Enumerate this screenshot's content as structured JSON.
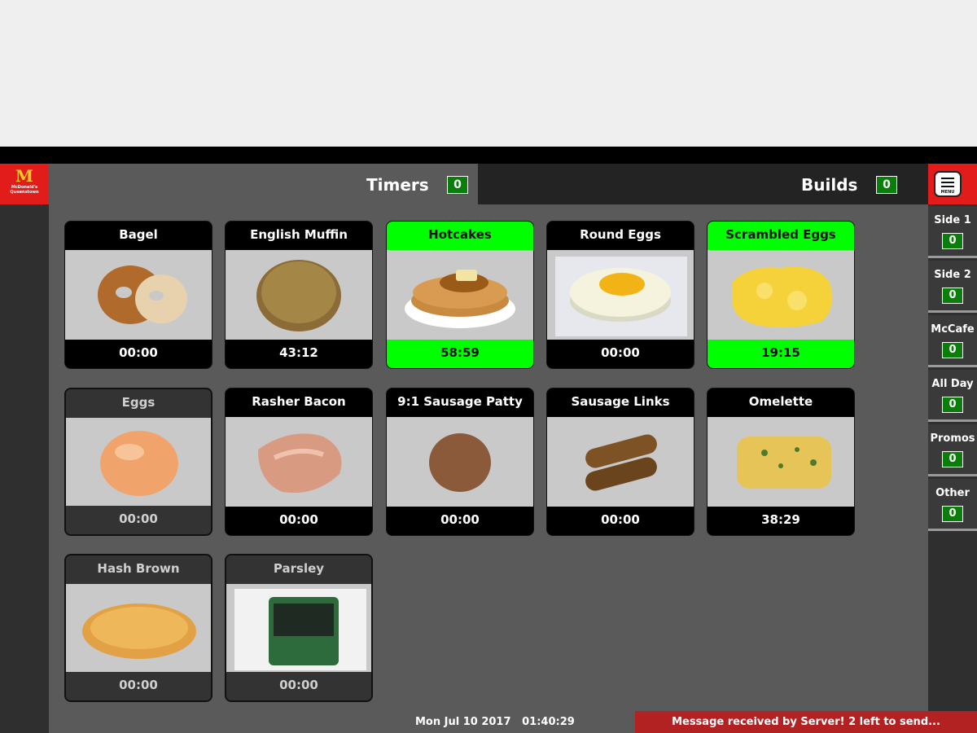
{
  "logo": {
    "store": "McDonald's Queenstown"
  },
  "tabs": {
    "timers": {
      "label": "Timers",
      "count": "0"
    },
    "builds": {
      "label": "Builds",
      "count": "0"
    }
  },
  "menu_label": "MENU",
  "side_items": [
    {
      "label": "Side 1",
      "count": "0"
    },
    {
      "label": "Side 2",
      "count": "0"
    },
    {
      "label": "McCafe",
      "count": "0"
    },
    {
      "label": "All Day",
      "count": "0"
    },
    {
      "label": "Promos",
      "count": "0"
    },
    {
      "label": "Other",
      "count": "0"
    }
  ],
  "tiles": [
    {
      "name": "Bagel",
      "time": "00:00",
      "state": "normal",
      "icon": "bagel-icon"
    },
    {
      "name": "English Muffin",
      "time": "43:12",
      "state": "normal",
      "icon": "english-muffin-icon"
    },
    {
      "name": "Hotcakes",
      "time": "58:59",
      "state": "active",
      "icon": "hotcakes-icon"
    },
    {
      "name": "Round Eggs",
      "time": "00:00",
      "state": "normal",
      "icon": "round-eggs-icon"
    },
    {
      "name": "Scrambled Eggs",
      "time": "19:15",
      "state": "active",
      "icon": "scrambled-eggs-icon"
    },
    {
      "name": "Eggs",
      "time": "00:00",
      "state": "inactive",
      "icon": "egg-icon"
    },
    {
      "name": "Rasher Bacon",
      "time": "00:00",
      "state": "normal",
      "icon": "bacon-icon"
    },
    {
      "name": "9:1 Sausage Patty",
      "time": "00:00",
      "state": "normal",
      "icon": "sausage-patty-icon"
    },
    {
      "name": "Sausage Links",
      "time": "00:00",
      "state": "normal",
      "icon": "sausage-links-icon"
    },
    {
      "name": "Omelette",
      "time": "38:29",
      "state": "normal",
      "icon": "omelette-icon"
    },
    {
      "name": "Hash Brown",
      "time": "00:00",
      "state": "inactive",
      "icon": "hash-brown-icon"
    },
    {
      "name": "Parsley",
      "time": "00:00",
      "state": "inactive",
      "icon": "parsley-icon"
    }
  ],
  "status": {
    "date": "Mon Jul 10 2017",
    "time": "01:40:29",
    "message": "Message received by Server! 2 left to send..."
  },
  "colors": {
    "brand_red": "#e21b1b",
    "active_green": "#00ff00",
    "count_green": "#0a7d0a"
  }
}
